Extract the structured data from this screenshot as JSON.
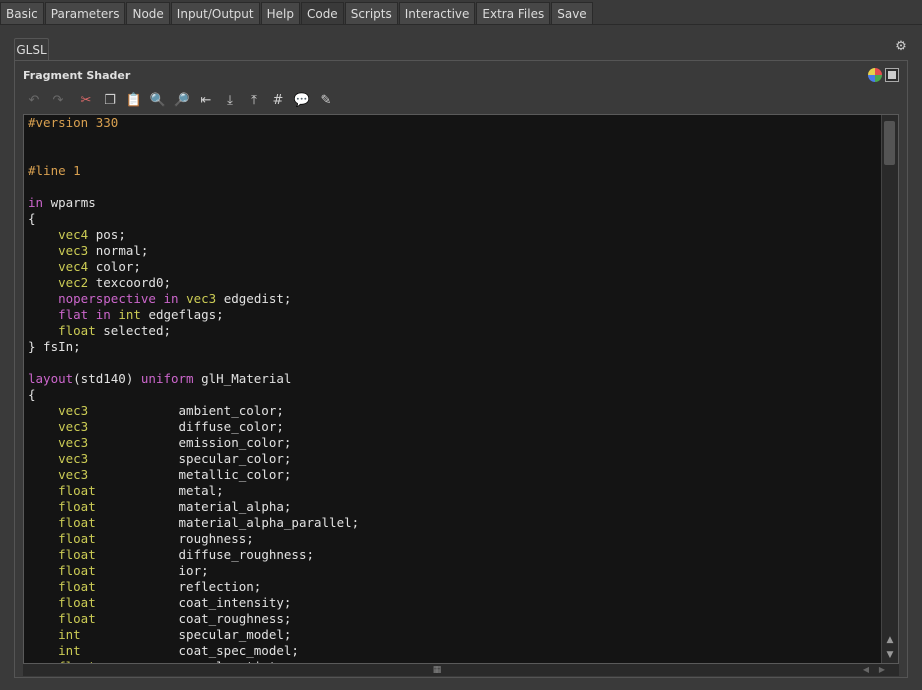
{
  "top_tabs": [
    {
      "label": "Basic",
      "active": false
    },
    {
      "label": "Parameters",
      "active": false
    },
    {
      "label": "Node",
      "active": false
    },
    {
      "label": "Input/Output",
      "active": false
    },
    {
      "label": "Help",
      "active": false
    },
    {
      "label": "Code",
      "active": true
    },
    {
      "label": "Scripts",
      "active": false
    },
    {
      "label": "Interactive",
      "active": false
    },
    {
      "label": "Extra Files",
      "active": false
    },
    {
      "label": "Save",
      "active": false
    }
  ],
  "subtab": {
    "label": "GLSL"
  },
  "panel": {
    "title": "Fragment Shader",
    "header_icons": [
      "color-scheme-icon",
      "window-mode-icon"
    ],
    "gear_icon": "gear-icon"
  },
  "toolbar": {
    "items": [
      {
        "name": "undo-icon",
        "glyph": "↶",
        "enabled": false
      },
      {
        "name": "redo-icon",
        "glyph": "↷",
        "enabled": false
      },
      {
        "name": "cut-icon",
        "glyph": "✂",
        "enabled": true
      },
      {
        "name": "copy-icon",
        "glyph": "❐",
        "enabled": true
      },
      {
        "name": "paste-icon",
        "glyph": "📋",
        "enabled": true
      },
      {
        "name": "find-icon",
        "glyph": "🔍",
        "enabled": true
      },
      {
        "name": "find-replace-icon",
        "glyph": "🔎",
        "enabled": true
      },
      {
        "name": "unindent-icon",
        "glyph": "⇤",
        "enabled": true
      },
      {
        "name": "import-file-icon",
        "glyph": "⤓",
        "enabled": true
      },
      {
        "name": "export-file-icon",
        "glyph": "⤒",
        "enabled": true
      },
      {
        "name": "comment-icon",
        "glyph": "#",
        "enabled": true
      },
      {
        "name": "uncomment-icon",
        "glyph": "💬",
        "enabled": true
      },
      {
        "name": "notes-icon",
        "glyph": "✎",
        "enabled": true
      }
    ]
  },
  "colors": {
    "keyword": "#cc66cc",
    "type": "#cccc55",
    "preprocessor": "#d8a050",
    "text": "#e2e2e2"
  },
  "code_lines": [
    [
      [
        "pp",
        "#version 330"
      ]
    ],
    [],
    [],
    [
      [
        "pp",
        "#line 1"
      ]
    ],
    [],
    [
      [
        "kw",
        "in"
      ],
      [
        "tx",
        " wparms"
      ]
    ],
    [
      [
        "tx",
        "{"
      ]
    ],
    [
      [
        "tx",
        "    "
      ],
      [
        "ty",
        "vec4"
      ],
      [
        "tx",
        " pos;"
      ]
    ],
    [
      [
        "tx",
        "    "
      ],
      [
        "ty",
        "vec3"
      ],
      [
        "tx",
        " normal;"
      ]
    ],
    [
      [
        "tx",
        "    "
      ],
      [
        "ty",
        "vec4"
      ],
      [
        "tx",
        " color;"
      ]
    ],
    [
      [
        "tx",
        "    "
      ],
      [
        "ty",
        "vec2"
      ],
      [
        "tx",
        " texcoord0;"
      ]
    ],
    [
      [
        "tx",
        "    "
      ],
      [
        "kw",
        "noperspective"
      ],
      [
        "tx",
        " "
      ],
      [
        "kw",
        "in"
      ],
      [
        "tx",
        " "
      ],
      [
        "ty",
        "vec3"
      ],
      [
        "tx",
        " edgedist;"
      ]
    ],
    [
      [
        "tx",
        "    "
      ],
      [
        "kw",
        "flat"
      ],
      [
        "tx",
        " "
      ],
      [
        "kw",
        "in"
      ],
      [
        "tx",
        " "
      ],
      [
        "ty",
        "int"
      ],
      [
        "tx",
        " edgeflags;"
      ]
    ],
    [
      [
        "tx",
        "    "
      ],
      [
        "ty",
        "float"
      ],
      [
        "tx",
        " selected;"
      ]
    ],
    [
      [
        "tx",
        "} fsIn;"
      ]
    ],
    [],
    [
      [
        "kw",
        "layout"
      ],
      [
        "tx",
        "(std140) "
      ],
      [
        "kw",
        "uniform"
      ],
      [
        "tx",
        " glH_Material"
      ]
    ],
    [
      [
        "tx",
        "{"
      ]
    ],
    [
      [
        "tx",
        "    "
      ],
      [
        "ty",
        "vec3"
      ],
      [
        "tx",
        "            ambient_color;"
      ]
    ],
    [
      [
        "tx",
        "    "
      ],
      [
        "ty",
        "vec3"
      ],
      [
        "tx",
        "            diffuse_color;"
      ]
    ],
    [
      [
        "tx",
        "    "
      ],
      [
        "ty",
        "vec3"
      ],
      [
        "tx",
        "            emission_color;"
      ]
    ],
    [
      [
        "tx",
        "    "
      ],
      [
        "ty",
        "vec3"
      ],
      [
        "tx",
        "            specular_color;"
      ]
    ],
    [
      [
        "tx",
        "    "
      ],
      [
        "ty",
        "vec3"
      ],
      [
        "tx",
        "            metallic_color;"
      ]
    ],
    [
      [
        "tx",
        "    "
      ],
      [
        "ty",
        "float"
      ],
      [
        "tx",
        "           metal;"
      ]
    ],
    [
      [
        "tx",
        "    "
      ],
      [
        "ty",
        "float"
      ],
      [
        "tx",
        "           material_alpha;"
      ]
    ],
    [
      [
        "tx",
        "    "
      ],
      [
        "ty",
        "float"
      ],
      [
        "tx",
        "           material_alpha_parallel;"
      ]
    ],
    [
      [
        "tx",
        "    "
      ],
      [
        "ty",
        "float"
      ],
      [
        "tx",
        "           roughness;"
      ]
    ],
    [
      [
        "tx",
        "    "
      ],
      [
        "ty",
        "float"
      ],
      [
        "tx",
        "           diffuse_roughness;"
      ]
    ],
    [
      [
        "tx",
        "    "
      ],
      [
        "ty",
        "float"
      ],
      [
        "tx",
        "           ior;"
      ]
    ],
    [
      [
        "tx",
        "    "
      ],
      [
        "ty",
        "float"
      ],
      [
        "tx",
        "           reflection;"
      ]
    ],
    [
      [
        "tx",
        "    "
      ],
      [
        "ty",
        "float"
      ],
      [
        "tx",
        "           coat_intensity;"
      ]
    ],
    [
      [
        "tx",
        "    "
      ],
      [
        "ty",
        "float"
      ],
      [
        "tx",
        "           coat_roughness;"
      ]
    ],
    [
      [
        "tx",
        "    "
      ],
      [
        "ty",
        "int"
      ],
      [
        "tx",
        "             specular_model;"
      ]
    ],
    [
      [
        "tx",
        "    "
      ],
      [
        "ty",
        "int"
      ],
      [
        "tx",
        "             coat_spec_model;"
      ]
    ],
    [
      [
        "tx",
        "    "
      ],
      [
        "ty",
        "float"
      ],
      [
        "tx",
        "           specular_tint;"
      ]
    ]
  ]
}
